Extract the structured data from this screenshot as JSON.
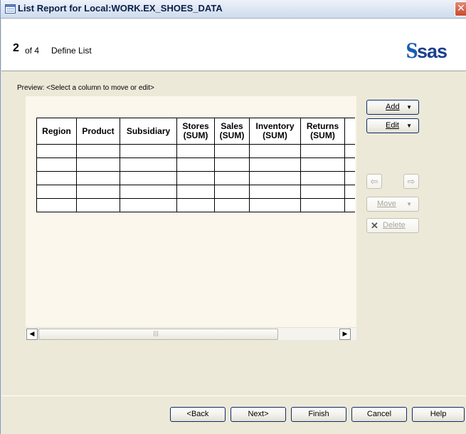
{
  "window": {
    "title": "List Report for Local:WORK.EX_SHOES_DATA",
    "close_glyph": "✕"
  },
  "header": {
    "step_number": "2",
    "step_of": "of 4",
    "step_title": "Define List",
    "logo_text": "sas",
    "logo_mark": "S"
  },
  "preview": {
    "label": "Preview: <Select a column to move or edit>"
  },
  "table": {
    "columns": [
      {
        "line1": "Region",
        "line2": ""
      },
      {
        "line1": "Product",
        "line2": ""
      },
      {
        "line1": "Subsidiary",
        "line2": ""
      },
      {
        "line1": "Stores",
        "line2": "(SUM)"
      },
      {
        "line1": "Sales",
        "line2": "(SUM)"
      },
      {
        "line1": "Inventory",
        "line2": "(SUM)"
      },
      {
        "line1": "Returns",
        "line2": "(SUM)"
      }
    ],
    "empty_rows": 5
  },
  "scrollbar": {
    "left_arrow": "◀",
    "right_arrow": "▶",
    "grip": "|||"
  },
  "side_buttons": {
    "add": {
      "label": "Add",
      "arrow": "▼"
    },
    "edit": {
      "label": "Edit",
      "arrow": "▼"
    },
    "move_left_icon": "⇦",
    "move_right_icon": "⇨",
    "move": {
      "label": "Move",
      "arrow": "▼"
    },
    "delete": {
      "label": "Delete",
      "icon": "✕"
    }
  },
  "footer": {
    "back": "<Back",
    "next": "Next>",
    "finish": "Finish",
    "cancel": "Cancel",
    "help": "Help"
  }
}
